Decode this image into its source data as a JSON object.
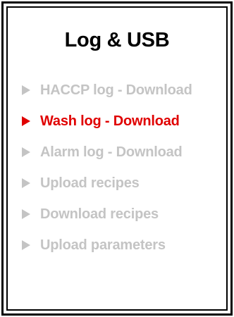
{
  "screen": {
    "title": "Log & USB"
  },
  "menu": {
    "items": [
      {
        "label": "HACCP log - Download",
        "selected": false
      },
      {
        "label": "Wash log - Download",
        "selected": true
      },
      {
        "label": "Alarm log - Download",
        "selected": false
      },
      {
        "label": "Upload recipes",
        "selected": false
      },
      {
        "label": "Download recipes",
        "selected": false
      },
      {
        "label": "Upload parameters",
        "selected": false
      }
    ]
  },
  "colors": {
    "selected": "#e00000",
    "inactive": "#c4c4c4",
    "title": "#000000",
    "border": "#000000"
  }
}
